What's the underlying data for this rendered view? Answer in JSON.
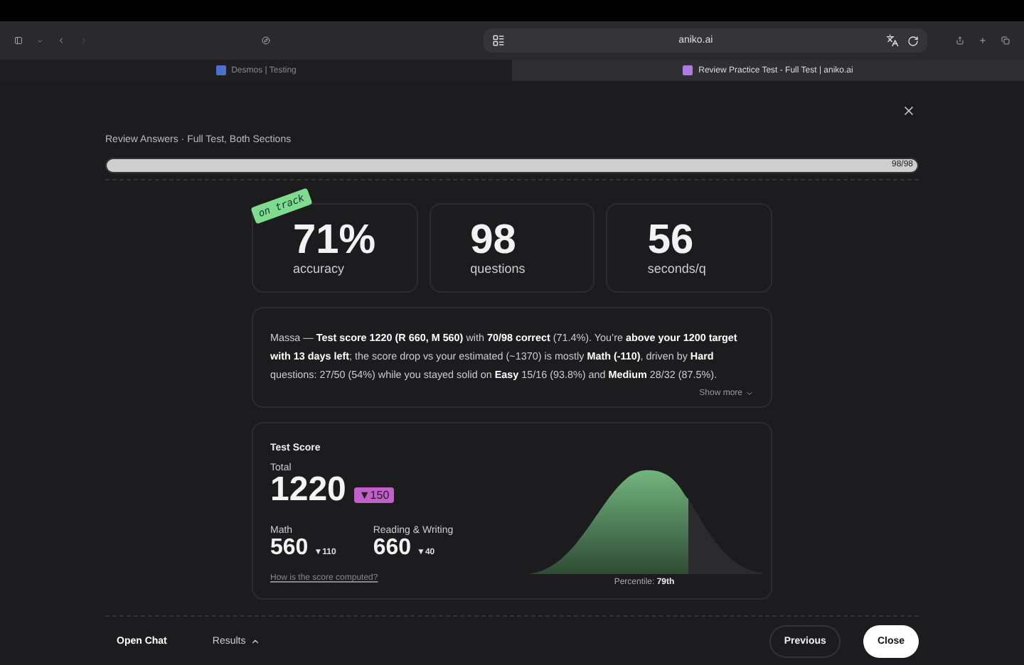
{
  "browser": {
    "url": "aniko.ai",
    "tabs": [
      {
        "title": "Desmos | Testing",
        "selected": false
      },
      {
        "title": "Review Practice Test - Full Test | aniko.ai",
        "selected": true
      }
    ]
  },
  "header": {
    "title": "Review Answers · Full Test, Both Sections",
    "progress": {
      "level": 1,
      "reading": "98/98"
    }
  },
  "stats": [
    {
      "value": "71%",
      "label": "accuracy",
      "sticker": "on track"
    },
    {
      "value": "98",
      "label": "questions"
    },
    {
      "value": "56",
      "label": "seconds/q"
    }
  ],
  "summary": {
    "text": "Massa — **Test score 1220 (R 660, M 560)** with **70/98 correct** (71.4%). You’re **above your 1200 target with 13 days left**; the score drop vs your estimated (~1370) is mostly **Math (-110)**, driven by **Hard** questions: 27/50 (54%) while you stayed solid on **Easy** 15/16 (93.8%) and **Medium** 28/32 (87.5%).",
    "more": "Show more"
  },
  "score": {
    "title": "Test Score",
    "total_label": "Total",
    "total": "1220",
    "total_delta": "▼150",
    "sections": [
      {
        "label": "Math",
        "value": "560",
        "delta": "▼110"
      },
      {
        "label": "Reading & Writing",
        "value": "660",
        "delta": "▼40"
      }
    ],
    "link": "How is the score computed?",
    "percentile_label": "Percentile:",
    "percentile": "79th"
  },
  "footer": {
    "left": [
      "Open Chat",
      "Results"
    ],
    "previous": "Previous",
    "close": "Close"
  }
}
